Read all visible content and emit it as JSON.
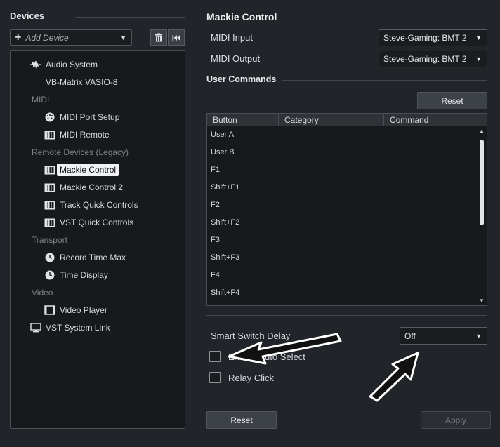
{
  "devices": {
    "title": "Devices",
    "add_device_placeholder": "Add Device",
    "tree": [
      {
        "type": "item",
        "label": "Audio System",
        "icon": "waveform-icon"
      },
      {
        "type": "item",
        "label": "VB-Matrix VASIO-8",
        "icon": ""
      },
      {
        "type": "category",
        "label": "MIDI"
      },
      {
        "type": "item",
        "label": "MIDI Port Setup",
        "icon": "midi-port-icon"
      },
      {
        "type": "item",
        "label": "MIDI Remote",
        "icon": "keyboard-icon"
      },
      {
        "type": "category",
        "label": "Remote Devices (Legacy)"
      },
      {
        "type": "item",
        "label": "Mackie Control",
        "icon": "keyboard-icon",
        "selected": true
      },
      {
        "type": "item",
        "label": "Mackie Control 2",
        "icon": "keyboard-icon"
      },
      {
        "type": "item",
        "label": "Track Quick Controls",
        "icon": "keyboard-icon"
      },
      {
        "type": "item",
        "label": "VST Quick Controls",
        "icon": "keyboard-icon"
      },
      {
        "type": "category",
        "label": "Transport"
      },
      {
        "type": "item",
        "label": "Record Time Max",
        "icon": "clock-icon"
      },
      {
        "type": "item",
        "label": "Time Display",
        "icon": "clock-icon"
      },
      {
        "type": "category",
        "label": "Video"
      },
      {
        "type": "item",
        "label": "Video Player",
        "icon": "film-icon"
      },
      {
        "type": "item",
        "label": "VST System Link",
        "icon": "monitor-icon"
      }
    ]
  },
  "mackie": {
    "title": "Mackie Control",
    "midi_input_label": "MIDI Input",
    "midi_input_value": "Steve-Gaming: BMT 2",
    "midi_output_label": "MIDI Output",
    "midi_output_value": "Steve-Gaming: BMT 2",
    "user_commands_label": "User Commands",
    "reset_label": "Reset",
    "columns": [
      "Button",
      "Category",
      "Command"
    ],
    "rows": [
      "User A",
      "User B",
      "F1",
      "Shift+F1",
      "F2",
      "Shift+F2",
      "F3",
      "Shift+F3",
      "F4",
      "Shift+F4"
    ],
    "smart_switch_label": "Smart Switch Delay",
    "smart_switch_value": "Off",
    "enable_auto_select_label": "Enable Auto Select",
    "relay_click_label": "Relay Click",
    "bottom_reset_label": "Reset",
    "apply_label": "Apply"
  }
}
